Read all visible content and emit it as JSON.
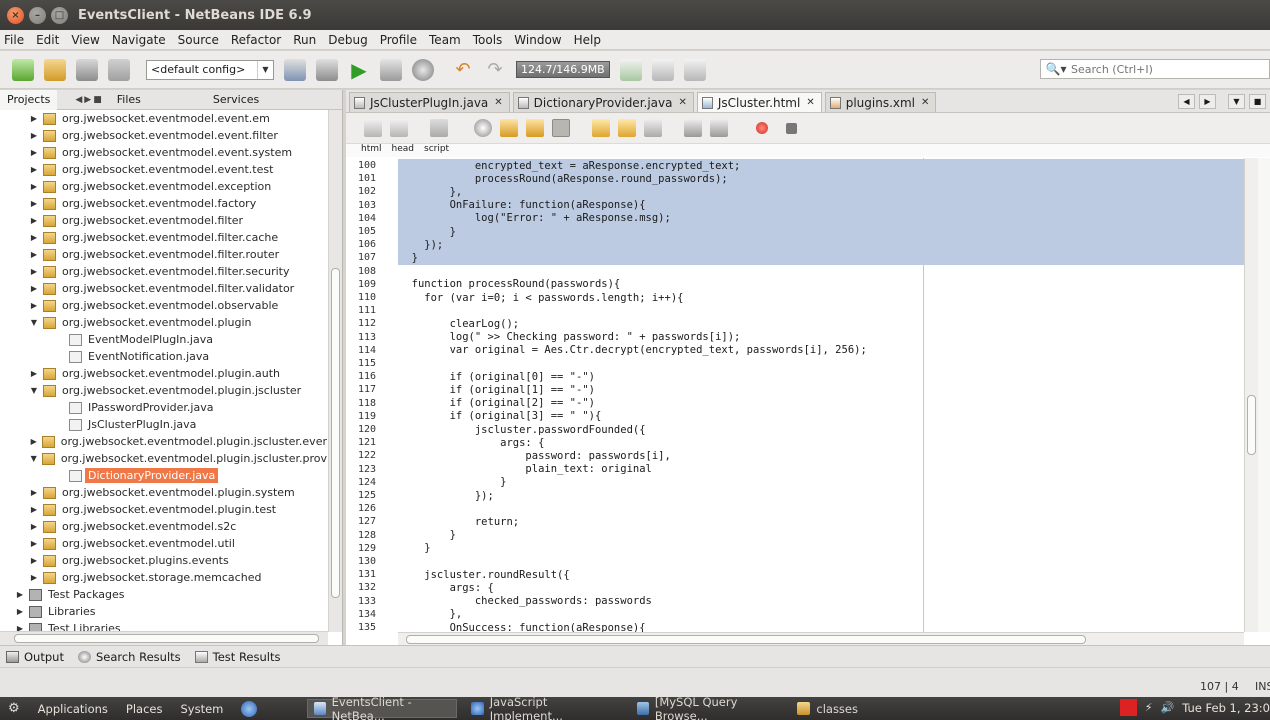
{
  "window": {
    "title": "EventsClient - NetBeans IDE 6.9"
  },
  "menu": [
    "File",
    "Edit",
    "View",
    "Navigate",
    "Source",
    "Refactor",
    "Run",
    "Debug",
    "Profile",
    "Team",
    "Tools",
    "Window",
    "Help"
  ],
  "toolbar": {
    "config": "<default config>",
    "memory": "124.7/146.9MB",
    "search_placeholder": "Search (Ctrl+I)"
  },
  "left_panel": {
    "tabs": [
      "Projects",
      "Files",
      "Services"
    ],
    "tree": [
      {
        "label": "org.jwebsocket.eventmodel.event.em",
        "toggle": "▶",
        "icon": "pkg",
        "indent": 1
      },
      {
        "label": "org.jwebsocket.eventmodel.event.filter",
        "toggle": "▶",
        "icon": "pkg",
        "indent": 1
      },
      {
        "label": "org.jwebsocket.eventmodel.event.system",
        "toggle": "▶",
        "icon": "pkg",
        "indent": 1
      },
      {
        "label": "org.jwebsocket.eventmodel.event.test",
        "toggle": "▶",
        "icon": "pkg",
        "indent": 1
      },
      {
        "label": "org.jwebsocket.eventmodel.exception",
        "toggle": "▶",
        "icon": "pkg",
        "indent": 1
      },
      {
        "label": "org.jwebsocket.eventmodel.factory",
        "toggle": "▶",
        "icon": "pkg",
        "indent": 1
      },
      {
        "label": "org.jwebsocket.eventmodel.filter",
        "toggle": "▶",
        "icon": "pkg",
        "indent": 1
      },
      {
        "label": "org.jwebsocket.eventmodel.filter.cache",
        "toggle": "▶",
        "icon": "pkg",
        "indent": 1
      },
      {
        "label": "org.jwebsocket.eventmodel.filter.router",
        "toggle": "▶",
        "icon": "pkg",
        "indent": 1
      },
      {
        "label": "org.jwebsocket.eventmodel.filter.security",
        "toggle": "▶",
        "icon": "pkg",
        "indent": 1
      },
      {
        "label": "org.jwebsocket.eventmodel.filter.validator",
        "toggle": "▶",
        "icon": "pkg",
        "indent": 1
      },
      {
        "label": "org.jwebsocket.eventmodel.observable",
        "toggle": "▶",
        "icon": "pkg",
        "indent": 1
      },
      {
        "label": "org.jwebsocket.eventmodel.plugin",
        "toggle": "▼",
        "icon": "pkg",
        "indent": 1
      },
      {
        "label": "EventModelPlugIn.java",
        "toggle": "",
        "icon": "file",
        "indent": 2
      },
      {
        "label": "EventNotification.java",
        "toggle": "",
        "icon": "file",
        "indent": 2
      },
      {
        "label": "org.jwebsocket.eventmodel.plugin.auth",
        "toggle": "▶",
        "icon": "pkg",
        "indent": 1
      },
      {
        "label": "org.jwebsocket.eventmodel.plugin.jscluster",
        "toggle": "▼",
        "icon": "pkg",
        "indent": 1
      },
      {
        "label": "IPasswordProvider.java",
        "toggle": "",
        "icon": "file",
        "indent": 2
      },
      {
        "label": "JsClusterPlugIn.java",
        "toggle": "",
        "icon": "file",
        "indent": 2
      },
      {
        "label": "org.jwebsocket.eventmodel.plugin.jscluster.ever",
        "toggle": "▶",
        "icon": "pkg",
        "indent": 1
      },
      {
        "label": "org.jwebsocket.eventmodel.plugin.jscluster.prov",
        "toggle": "▼",
        "icon": "pkg",
        "indent": 1
      },
      {
        "label": "DictionaryProvider.java",
        "toggle": "",
        "icon": "file",
        "indent": 2,
        "selected": true
      },
      {
        "label": "org.jwebsocket.eventmodel.plugin.system",
        "toggle": "▶",
        "icon": "pkg",
        "indent": 1
      },
      {
        "label": "org.jwebsocket.eventmodel.plugin.test",
        "toggle": "▶",
        "icon": "pkg",
        "indent": 1
      },
      {
        "label": "org.jwebsocket.eventmodel.s2c",
        "toggle": "▶",
        "icon": "pkg",
        "indent": 1
      },
      {
        "label": "org.jwebsocket.eventmodel.util",
        "toggle": "▶",
        "icon": "pkg",
        "indent": 1
      },
      {
        "label": "org.jwebsocket.plugins.events",
        "toggle": "▶",
        "icon": "pkg",
        "indent": 1
      },
      {
        "label": "org.jwebsocket.storage.memcached",
        "toggle": "▶",
        "icon": "pkg",
        "indent": 1
      },
      {
        "label": "Test Packages",
        "toggle": "▶",
        "icon": "lib",
        "indent": 0
      },
      {
        "label": "Libraries",
        "toggle": "▶",
        "icon": "lib",
        "indent": 0
      },
      {
        "label": "Test Libraries",
        "toggle": "▶",
        "icon": "lib",
        "indent": 0
      }
    ]
  },
  "editor": {
    "tabs": [
      {
        "label": "JsClusterPlugIn.java",
        "active": false
      },
      {
        "label": "DictionaryProvider.java",
        "active": false
      },
      {
        "label": "JsCluster.html",
        "active": true
      },
      {
        "label": "plugins.xml",
        "active": false
      }
    ],
    "breadcrumbs": [
      "html",
      "head",
      "script"
    ],
    "lines": [
      {
        "n": "100",
        "t": "            encrypted_text = aResponse.encrypted_text;",
        "sel": true
      },
      {
        "n": "101",
        "t": "            processRound(aResponse.round_passwords);",
        "sel": true
      },
      {
        "n": "102",
        "t": "        },",
        "sel": true
      },
      {
        "n": "103",
        "t": "        OnFailure: function(aResponse){",
        "sel": true
      },
      {
        "n": "104",
        "t": "            log(\"Error: \" + aResponse.msg);",
        "sel": true
      },
      {
        "n": "105",
        "t": "        }",
        "sel": true
      },
      {
        "n": "106",
        "t": "    });",
        "sel": true
      },
      {
        "n": "107",
        "t": "  }",
        "sel": true
      },
      {
        "n": "108",
        "t": "",
        "sel": false
      },
      {
        "n": "109",
        "t": "  function processRound(passwords){",
        "sel": false
      },
      {
        "n": "110",
        "t": "    for (var i=0; i < passwords.length; i++){",
        "sel": false
      },
      {
        "n": "111",
        "t": "",
        "sel": false
      },
      {
        "n": "112",
        "t": "        clearLog();",
        "sel": false
      },
      {
        "n": "113",
        "t": "        log(\" >> Checking password: \" + passwords[i]);",
        "sel": false
      },
      {
        "n": "114",
        "t": "        var original = Aes.Ctr.decrypt(encrypted_text, passwords[i], 256);",
        "sel": false
      },
      {
        "n": "115",
        "t": "",
        "sel": false
      },
      {
        "n": "116",
        "t": "        if (original[0] == \"-\")",
        "sel": false
      },
      {
        "n": "117",
        "t": "        if (original[1] == \"-\")",
        "sel": false
      },
      {
        "n": "118",
        "t": "        if (original[2] == \"-\")",
        "sel": false
      },
      {
        "n": "119",
        "t": "        if (original[3] == \" \"){",
        "sel": false
      },
      {
        "n": "120",
        "t": "            jscluster.passwordFounded({",
        "sel": false
      },
      {
        "n": "121",
        "t": "                args: {",
        "sel": false
      },
      {
        "n": "122",
        "t": "                    password: passwords[i],",
        "sel": false
      },
      {
        "n": "123",
        "t": "                    plain_text: original",
        "sel": false
      },
      {
        "n": "124",
        "t": "                }",
        "sel": false
      },
      {
        "n": "125",
        "t": "            });",
        "sel": false
      },
      {
        "n": "126",
        "t": "",
        "sel": false
      },
      {
        "n": "127",
        "t": "            return;",
        "sel": false
      },
      {
        "n": "128",
        "t": "        }",
        "sel": false
      },
      {
        "n": "129",
        "t": "    }",
        "sel": false
      },
      {
        "n": "130",
        "t": "",
        "sel": false
      },
      {
        "n": "131",
        "t": "    jscluster.roundResult({",
        "sel": false
      },
      {
        "n": "132",
        "t": "        args: {",
        "sel": false
      },
      {
        "n": "133",
        "t": "            checked_passwords: passwords",
        "sel": false
      },
      {
        "n": "134",
        "t": "        },",
        "sel": false
      },
      {
        "n": "135",
        "t": "        OnSuccess: function(aResponse){",
        "sel": false
      }
    ]
  },
  "output_bar": {
    "output": "Output",
    "search_results": "Search Results",
    "test_results": "Test Results"
  },
  "status": {
    "position": "107 | 4",
    "mode": "INS"
  },
  "taskbar": {
    "applications": "Applications",
    "places": "Places",
    "system": "System",
    "tasks": [
      {
        "label": "EventsClient - NetBea...",
        "active": true
      },
      {
        "label": "JavaScript Implement...",
        "active": false
      },
      {
        "label": "[MySQL Query Browse...",
        "active": false
      },
      {
        "label": "classes",
        "active": false
      }
    ],
    "clock": "Tue Feb 1, 23:0"
  }
}
